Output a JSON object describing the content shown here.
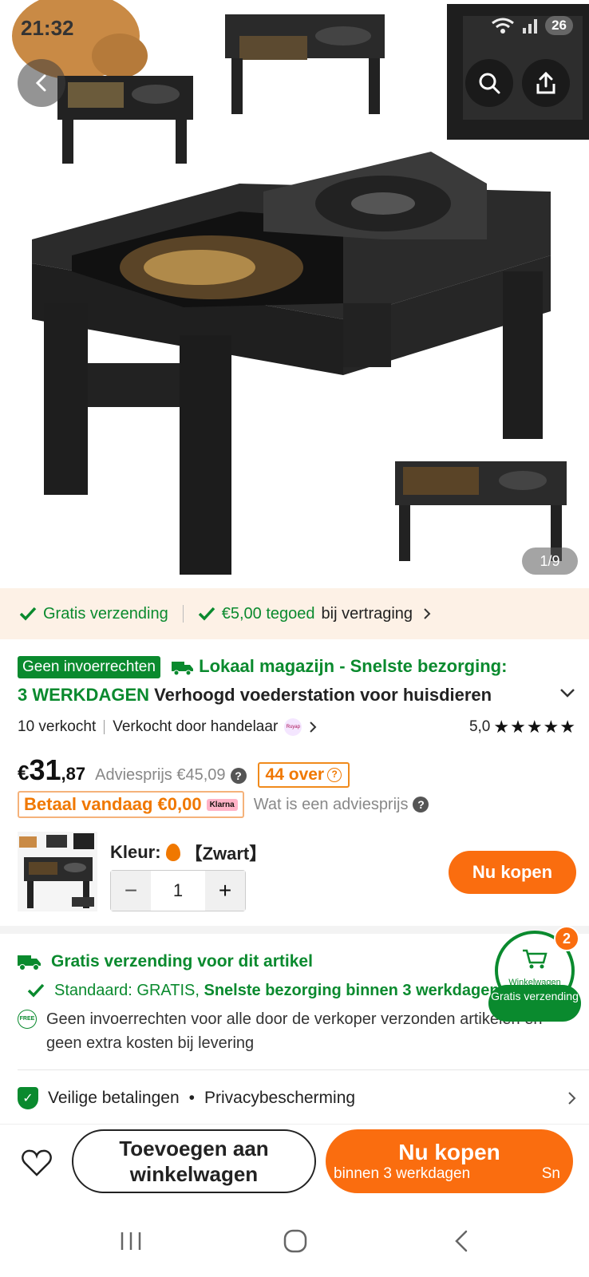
{
  "status_bar": {
    "time": "21:32",
    "battery": "26"
  },
  "gallery": {
    "page_indicator": "1/9"
  },
  "benefits": {
    "free_shipping": "Gratis verzending",
    "credit_amount": "€5,00 tegoed",
    "credit_suffix": "bij vertraging"
  },
  "title": {
    "badge": "Geen invoerrechten",
    "warehouse": "Lokaal magazijn - Snelste bezorging:",
    "days": "3 WERKDAGEN",
    "product": "Verhoogd voederstation voor huisdieren"
  },
  "meta": {
    "sold": "10 verkocht",
    "seller": "Verkocht door handelaar",
    "seller_logo": "Ruyap",
    "rating": "5,0",
    "stars": "★★★★★"
  },
  "price": {
    "currency": "€",
    "whole": "31",
    "cents": ",87",
    "advies": "Adviesprijs €45,09",
    "stock": "44 over",
    "pay_today": "Betaal vandaag €0,00",
    "klarna": "Klarna",
    "what_is": "Wat is een adviesprijs"
  },
  "variant": {
    "color_label": "Kleur:",
    "color_value": "【Zwart】",
    "quantity": "1",
    "minus": "−",
    "plus": "+",
    "buy_now": "Nu kopen"
  },
  "shipping": {
    "title": "Gratis verzending voor dit artikel",
    "standard_prefix": "Standaard: GRATIS, ",
    "standard_bold": "Snelste bezorging binnen 3 werkdagen",
    "free_icon": "FREE",
    "duties": "Geen invoerrechten voor alle door de verkoper verzonden artikelen en geen extra kosten bij levering"
  },
  "secure": {
    "payments": "Veilige betalingen",
    "dot": "•",
    "privacy": "Privacybescherming"
  },
  "floating_cart": {
    "count": "2",
    "label": "Winkelwagen",
    "pill": "Gratis verzending"
  },
  "bottom_bar": {
    "add_line1": "Toevoegen aan",
    "add_line2": "winkelwagen",
    "buy_title": "Nu kopen",
    "buy_sub": "binnen 3 werkdagen",
    "buy_sub_cut": "Sn"
  },
  "colors": {
    "green": "#0a8a2e",
    "orange": "#fa6d0f",
    "benefit_bg": "#fdf1e6"
  }
}
